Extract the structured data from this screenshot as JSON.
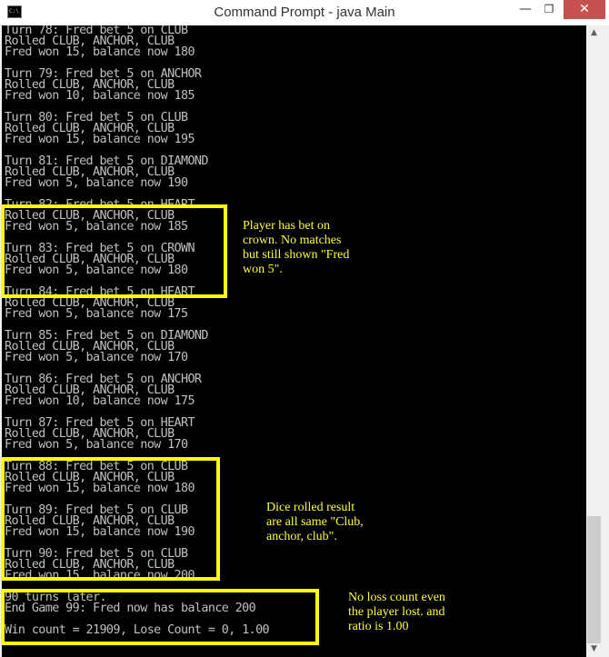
{
  "window": {
    "title": "Command Prompt - java  Main",
    "icon_label": "C:\\",
    "controls": {
      "minimize_glyph": "—",
      "maximize_glyph": "❐",
      "close_glyph": "✕"
    }
  },
  "console": {
    "lines": [
      "Turn 78: Fred bet 5 on CLUB",
      "Rolled CLUB, ANCHOR, CLUB",
      "Fred won 15, balance now 180",
      "",
      "Turn 79: Fred bet 5 on ANCHOR",
      "Rolled CLUB, ANCHOR, CLUB",
      "Fred won 10, balance now 185",
      "",
      "Turn 80: Fred bet 5 on CLUB",
      "Rolled CLUB, ANCHOR, CLUB",
      "Fred won 15, balance now 195",
      "",
      "Turn 81: Fred bet 5 on DIAMOND",
      "Rolled CLUB, ANCHOR, CLUB",
      "Fred won 5, balance now 190",
      "",
      "Turn 82: Fred bet 5 on HEART",
      "Rolled CLUB, ANCHOR, CLUB",
      "Fred won 5, balance now 185",
      "",
      "Turn 83: Fred bet 5 on CROWN",
      "Rolled CLUB, ANCHOR, CLUB",
      "Fred won 5, balance now 180",
      "",
      "Turn 84: Fred bet 5 on HEART",
      "Rolled CLUB, ANCHOR, CLUB",
      "Fred won 5, balance now 175",
      "",
      "Turn 85: Fred bet 5 on DIAMOND",
      "Rolled CLUB, ANCHOR, CLUB",
      "Fred won 5, balance now 170",
      "",
      "Turn 86: Fred bet 5 on ANCHOR",
      "Rolled CLUB, ANCHOR, CLUB",
      "Fred won 10, balance now 175",
      "",
      "Turn 87: Fred bet 5 on HEART",
      "Rolled CLUB, ANCHOR, CLUB",
      "Fred won 5, balance now 170",
      "",
      "Turn 88: Fred bet 5 on CLUB",
      "Rolled CLUB, ANCHOR, CLUB",
      "Fred won 15, balance now 180",
      "",
      "Turn 89: Fred bet 5 on CLUB",
      "Rolled CLUB, ANCHOR, CLUB",
      "Fred won 15, balance now 190",
      "",
      "Turn 90: Fred bet 5 on CLUB",
      "Rolled CLUB, ANCHOR, CLUB",
      "Fred won 15, balance now 200",
      "",
      "90 turns later.",
      "End Game 99: Fred now has balance 200",
      "",
      "Win count = 21909, Lose Count = 0, 1.00"
    ]
  },
  "annotations": {
    "note_1": "Player has bet on\ncrown. No matches\nbut still shown \"Fred\nwon 5\".",
    "note_2": "Dice rolled result\nare all same \"Club,\nanchor, club\".",
    "note_3": "No loss count even\nthe player lost. and\nratio is 1.00"
  },
  "colors": {
    "console_background": "#000000",
    "console_text": "#c0c0c0",
    "highlight": "#ffff00",
    "close_button": "#c75050"
  }
}
